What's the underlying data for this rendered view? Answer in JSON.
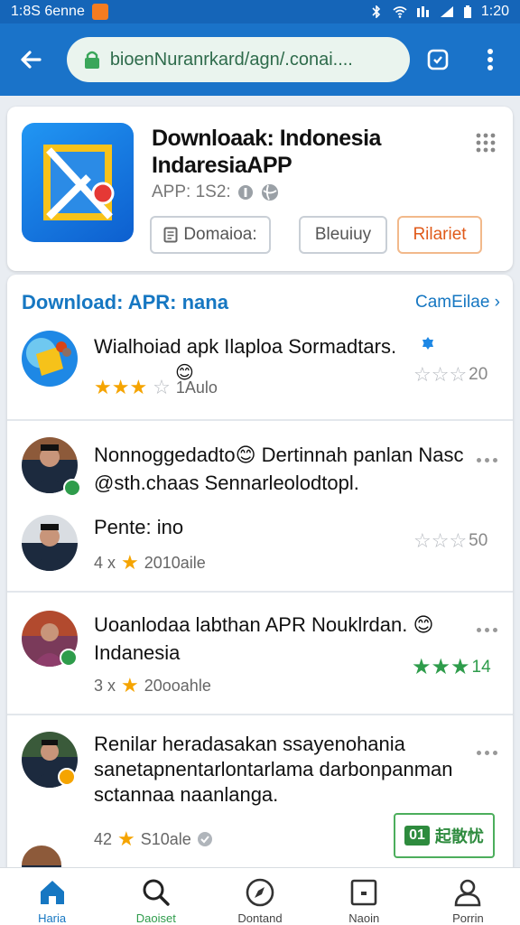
{
  "status_bar": {
    "left_text": "1:8S 6enne",
    "time": "1:20"
  },
  "browser": {
    "url": "bioenNuranrkard/agn/.conai....",
    "back_icon": "arrow-left-icon",
    "tab_icon": "tabs-icon",
    "menu_icon": "kebab-menu-icon"
  },
  "app": {
    "title": "Downloaak: Indonesia IndaresiaAPP",
    "meta": "APP: 1S2:",
    "buttons": {
      "download": "Domaioa:",
      "details": "Bleuiuy",
      "report": "Rilariet"
    }
  },
  "feed": {
    "title": "Download: APR: nana",
    "link": "CamEilae",
    "items": [
      {
        "text": "Wialhoiad apk  Ilaploa Sormadtars.",
        "rating_label": "1Aulo",
        "score": "20",
        "badge_color": "#f5a400"
      },
      {
        "text": "Nonnoggedadto😊 Dertinnah panlan Nasc @sth.chaas Sennarleolodtopl.",
        "badge_color": "#2e9c4b"
      },
      {
        "text": "Pente: ino",
        "meta_prefix": "4 х",
        "rating_label": "2010aile",
        "score": "50"
      },
      {
        "text": "Uoanlodaa labthan APR Nouklrdan. 😊 Indanesia",
        "meta_prefix": "3 х",
        "rating_label": "20ooahle",
        "score": "14"
      },
      {
        "text": "Renilar heradasakan ssayenohania sanetapnentarlontarlama darbonpanman sctannaa naanlanga.",
        "meta_prefix": "42",
        "rating_label": "S10ale",
        "cta": "起散忧",
        "cta_badge": "01"
      }
    ]
  },
  "bottom_nav": {
    "items": [
      {
        "label": "Haria",
        "icon": "home-icon"
      },
      {
        "label": "Daoiset",
        "icon": "search-icon"
      },
      {
        "label": "Dontand",
        "icon": "compass-icon"
      },
      {
        "label": "Naoin",
        "icon": "inbox-icon"
      },
      {
        "label": "Porrin",
        "icon": "user-icon"
      }
    ]
  },
  "colors": {
    "status_bar": "#1565b8",
    "toolbar": "#1a73c9",
    "accent_blue": "#1677c2",
    "accent_orange": "#e05a1a",
    "star_yellow": "#f5a400",
    "star_green": "#2e9c4b"
  }
}
